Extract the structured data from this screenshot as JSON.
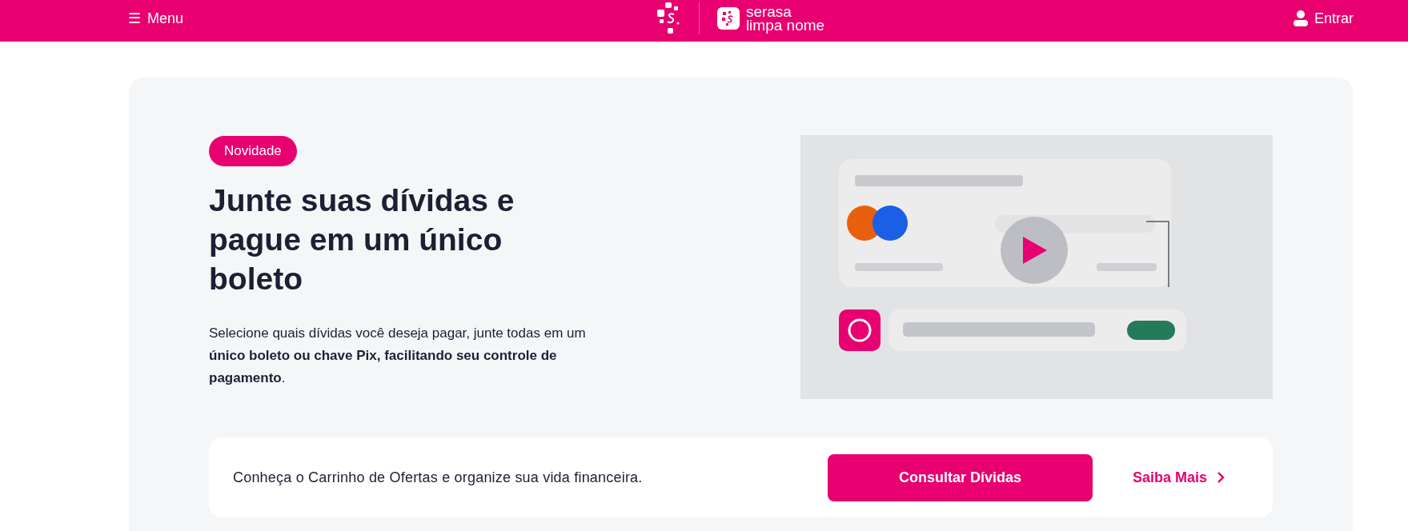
{
  "header": {
    "menu": {
      "icon": "☰",
      "label": "Menu"
    },
    "brand": {
      "line_1": "serasa",
      "line_2": "limpa nome"
    },
    "login": "Entrar"
  },
  "hero": {
    "badge": "Novidade",
    "title": "Junte suas dívidas e pague em um único boleto",
    "text": "Selecione quais dívidas você deseja pagar, junte todas em um **único boleto ou chave Pix, facilitando seu controle de pagamento**."
  },
  "cta": {
    "text": "Conheça o Carrinho de Ofertas e organize sua vida financeira.",
    "button": "Consultar Dívidas",
    "link": "Saiba Mais"
  }
}
